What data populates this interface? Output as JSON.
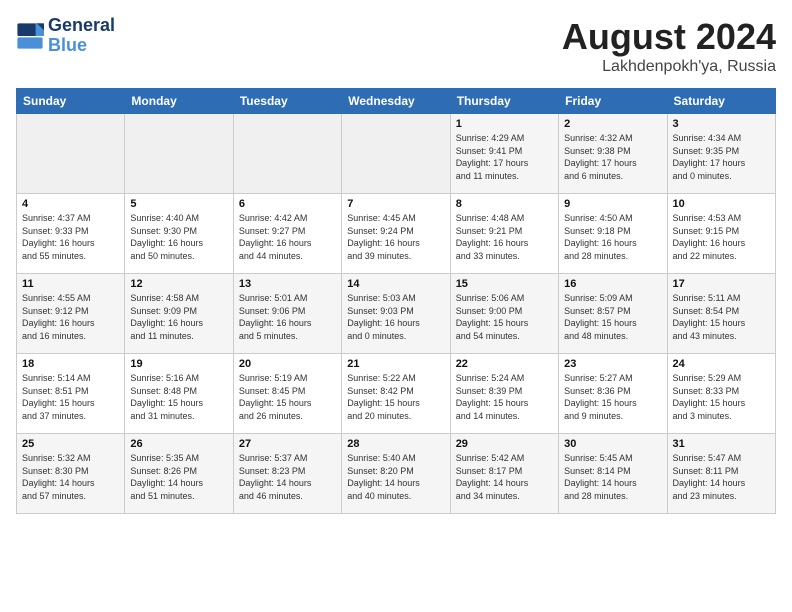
{
  "header": {
    "logo_line1": "General",
    "logo_line2": "Blue",
    "title": "August 2024",
    "subtitle": "Lakhdenpokh'ya, Russia"
  },
  "weekdays": [
    "Sunday",
    "Monday",
    "Tuesday",
    "Wednesday",
    "Thursday",
    "Friday",
    "Saturday"
  ],
  "weeks": [
    [
      {
        "day": "",
        "info": ""
      },
      {
        "day": "",
        "info": ""
      },
      {
        "day": "",
        "info": ""
      },
      {
        "day": "",
        "info": ""
      },
      {
        "day": "1",
        "info": "Sunrise: 4:29 AM\nSunset: 9:41 PM\nDaylight: 17 hours\nand 11 minutes."
      },
      {
        "day": "2",
        "info": "Sunrise: 4:32 AM\nSunset: 9:38 PM\nDaylight: 17 hours\nand 6 minutes."
      },
      {
        "day": "3",
        "info": "Sunrise: 4:34 AM\nSunset: 9:35 PM\nDaylight: 17 hours\nand 0 minutes."
      }
    ],
    [
      {
        "day": "4",
        "info": "Sunrise: 4:37 AM\nSunset: 9:33 PM\nDaylight: 16 hours\nand 55 minutes."
      },
      {
        "day": "5",
        "info": "Sunrise: 4:40 AM\nSunset: 9:30 PM\nDaylight: 16 hours\nand 50 minutes."
      },
      {
        "day": "6",
        "info": "Sunrise: 4:42 AM\nSunset: 9:27 PM\nDaylight: 16 hours\nand 44 minutes."
      },
      {
        "day": "7",
        "info": "Sunrise: 4:45 AM\nSunset: 9:24 PM\nDaylight: 16 hours\nand 39 minutes."
      },
      {
        "day": "8",
        "info": "Sunrise: 4:48 AM\nSunset: 9:21 PM\nDaylight: 16 hours\nand 33 minutes."
      },
      {
        "day": "9",
        "info": "Sunrise: 4:50 AM\nSunset: 9:18 PM\nDaylight: 16 hours\nand 28 minutes."
      },
      {
        "day": "10",
        "info": "Sunrise: 4:53 AM\nSunset: 9:15 PM\nDaylight: 16 hours\nand 22 minutes."
      }
    ],
    [
      {
        "day": "11",
        "info": "Sunrise: 4:55 AM\nSunset: 9:12 PM\nDaylight: 16 hours\nand 16 minutes."
      },
      {
        "day": "12",
        "info": "Sunrise: 4:58 AM\nSunset: 9:09 PM\nDaylight: 16 hours\nand 11 minutes."
      },
      {
        "day": "13",
        "info": "Sunrise: 5:01 AM\nSunset: 9:06 PM\nDaylight: 16 hours\nand 5 minutes."
      },
      {
        "day": "14",
        "info": "Sunrise: 5:03 AM\nSunset: 9:03 PM\nDaylight: 16 hours\nand 0 minutes."
      },
      {
        "day": "15",
        "info": "Sunrise: 5:06 AM\nSunset: 9:00 PM\nDaylight: 15 hours\nand 54 minutes."
      },
      {
        "day": "16",
        "info": "Sunrise: 5:09 AM\nSunset: 8:57 PM\nDaylight: 15 hours\nand 48 minutes."
      },
      {
        "day": "17",
        "info": "Sunrise: 5:11 AM\nSunset: 8:54 PM\nDaylight: 15 hours\nand 43 minutes."
      }
    ],
    [
      {
        "day": "18",
        "info": "Sunrise: 5:14 AM\nSunset: 8:51 PM\nDaylight: 15 hours\nand 37 minutes."
      },
      {
        "day": "19",
        "info": "Sunrise: 5:16 AM\nSunset: 8:48 PM\nDaylight: 15 hours\nand 31 minutes."
      },
      {
        "day": "20",
        "info": "Sunrise: 5:19 AM\nSunset: 8:45 PM\nDaylight: 15 hours\nand 26 minutes."
      },
      {
        "day": "21",
        "info": "Sunrise: 5:22 AM\nSunset: 8:42 PM\nDaylight: 15 hours\nand 20 minutes."
      },
      {
        "day": "22",
        "info": "Sunrise: 5:24 AM\nSunset: 8:39 PM\nDaylight: 15 hours\nand 14 minutes."
      },
      {
        "day": "23",
        "info": "Sunrise: 5:27 AM\nSunset: 8:36 PM\nDaylight: 15 hours\nand 9 minutes."
      },
      {
        "day": "24",
        "info": "Sunrise: 5:29 AM\nSunset: 8:33 PM\nDaylight: 15 hours\nand 3 minutes."
      }
    ],
    [
      {
        "day": "25",
        "info": "Sunrise: 5:32 AM\nSunset: 8:30 PM\nDaylight: 14 hours\nand 57 minutes."
      },
      {
        "day": "26",
        "info": "Sunrise: 5:35 AM\nSunset: 8:26 PM\nDaylight: 14 hours\nand 51 minutes."
      },
      {
        "day": "27",
        "info": "Sunrise: 5:37 AM\nSunset: 8:23 PM\nDaylight: 14 hours\nand 46 minutes."
      },
      {
        "day": "28",
        "info": "Sunrise: 5:40 AM\nSunset: 8:20 PM\nDaylight: 14 hours\nand 40 minutes."
      },
      {
        "day": "29",
        "info": "Sunrise: 5:42 AM\nSunset: 8:17 PM\nDaylight: 14 hours\nand 34 minutes."
      },
      {
        "day": "30",
        "info": "Sunrise: 5:45 AM\nSunset: 8:14 PM\nDaylight: 14 hours\nand 28 minutes."
      },
      {
        "day": "31",
        "info": "Sunrise: 5:47 AM\nSunset: 8:11 PM\nDaylight: 14 hours\nand 23 minutes."
      }
    ]
  ]
}
